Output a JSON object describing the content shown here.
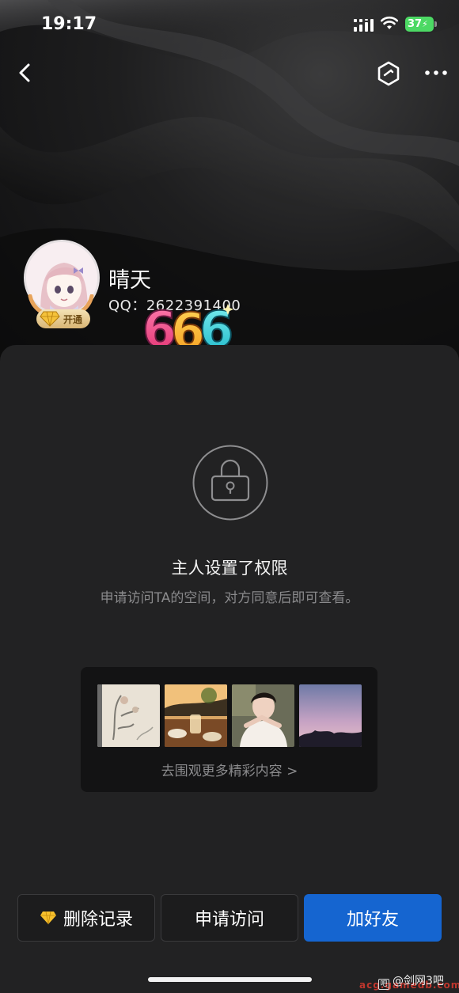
{
  "status_bar": {
    "time": "19:17",
    "battery": "37"
  },
  "profile": {
    "name": "晴天",
    "qq_label": "QQ：",
    "qq_number": "2622391400",
    "vip_badge": "开通",
    "sticker_text": "666"
  },
  "permission": {
    "title": "主人设置了权限",
    "subtitle": "申请访问TA的空间，对方同意后即可查看。"
  },
  "gallery": {
    "link_text": "去围观更多精彩内容 >",
    "thumbnails": [
      "ink-painting-thumbnail",
      "dining-table-thumbnail",
      "portrait-thumbnail",
      "sunset-sky-thumbnail"
    ]
  },
  "actions": {
    "delete_label": "删除记录",
    "apply_label": "申请访问",
    "add_label": "加好友"
  },
  "watermark": {
    "main": "@剑网3吧",
    "sub": "acg.gamedb.com"
  },
  "colors": {
    "primary_button": "#1565d0",
    "sheet": "#222223",
    "battery": "#4cd964"
  }
}
